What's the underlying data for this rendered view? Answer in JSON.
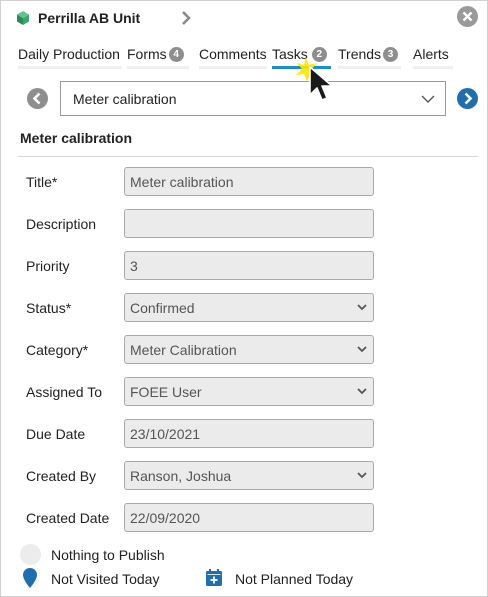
{
  "header": {
    "title": "Perrilla AB Unit"
  },
  "tabs": [
    {
      "label": "Daily Production",
      "badge": ""
    },
    {
      "label": "Forms",
      "badge": "4"
    },
    {
      "label": "Comments",
      "badge": ""
    },
    {
      "label": "Tasks",
      "badge": "2",
      "active": true
    },
    {
      "label": "Trends",
      "badge": "3"
    },
    {
      "label": "Alerts",
      "badge": ""
    }
  ],
  "task_selector": {
    "selected": "Meter calibration"
  },
  "section": {
    "title": "Meter calibration"
  },
  "form": {
    "title_label": "Title*",
    "title_value": "Meter calibration",
    "description_label": "Description",
    "description_value": "",
    "priority_label": "Priority",
    "priority_value": "3",
    "status_label": "Status*",
    "status_value": "Confirmed",
    "category_label": "Category*",
    "category_value": "Meter Calibration",
    "assigned_label": "Assigned To",
    "assigned_value": "FOEE User",
    "due_label": "Due Date",
    "due_value": "23/10/2021",
    "created_by_label": "Created By",
    "created_by_value": "Ranson, Joshua",
    "created_date_label": "Created Date",
    "created_date_value": "22/09/2020"
  },
  "footer": {
    "publish_status": "Nothing to Publish",
    "visit_status": "Not Visited Today",
    "plan_status": "Not Planned Today"
  },
  "colors": {
    "accent_blue": "#1f8ec4",
    "nav_next_blue": "#1f6fb0",
    "logo_green": "#3aa76d",
    "cursor_highlight": "#ffe600"
  },
  "icons": [
    "app-logo-icon",
    "chevron-right-icon",
    "close-icon",
    "chevron-left-circle-icon",
    "chevron-right-circle-icon",
    "chevron-down-icon",
    "map-pin-icon",
    "calendar-plus-icon",
    "mouse-pointer-icon"
  ]
}
